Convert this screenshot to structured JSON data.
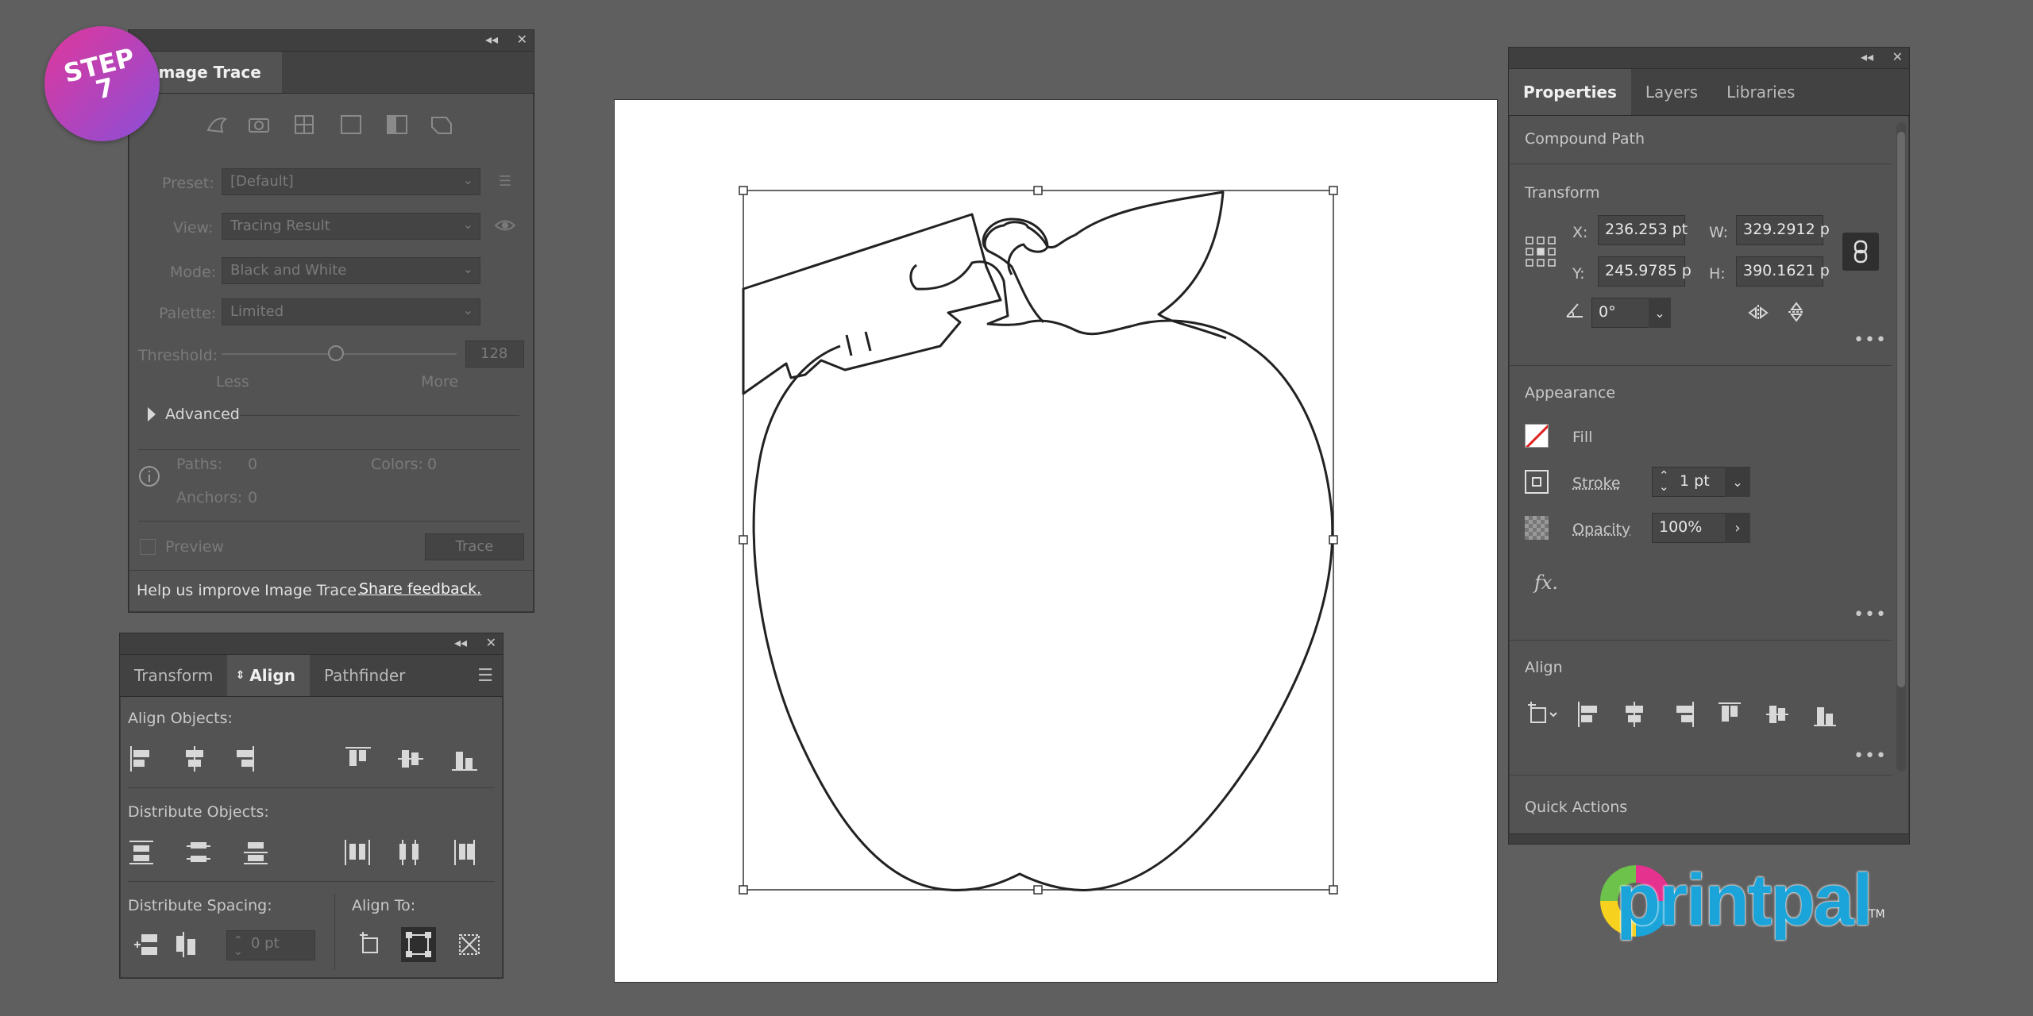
{
  "step_badge": {
    "line1": "STEP",
    "line2": "7"
  },
  "image_trace": {
    "tab_title": "Image Trace",
    "preset_label": "Preset:",
    "preset_value": "[Default]",
    "view_label": "View:",
    "view_value": "Tracing Result",
    "mode_label": "Mode:",
    "mode_value": "Black and White",
    "palette_label": "Palette:",
    "palette_value": "Limited",
    "threshold_label": "Threshold:",
    "threshold_value": "128",
    "less_label": "Less",
    "more_label": "More",
    "advanced_label": "Advanced",
    "paths_label": "Paths:",
    "paths_value": "0",
    "colors_label": "Colors:",
    "colors_value": "0",
    "anchors_label": "Anchors:",
    "anchors_value": "0",
    "preview_label": "Preview",
    "trace_button": "Trace",
    "help_text": "Help us improve Image Trace.",
    "feedback_link": "Share feedback."
  },
  "align_panel": {
    "tabs": [
      "Transform",
      "Align",
      "Pathfinder"
    ],
    "align_objects": "Align Objects:",
    "distribute_objects": "Distribute Objects:",
    "distribute_spacing": "Distribute Spacing:",
    "align_to": "Align To:",
    "spacing_value": "0 pt"
  },
  "properties": {
    "tabs": [
      "Properties",
      "Layers",
      "Libraries"
    ],
    "object_type": "Compound Path",
    "transform_title": "Transform",
    "x_label": "X:",
    "x_value": "236.253 pt",
    "y_label": "Y:",
    "y_value": "245.9785 p",
    "w_label": "W:",
    "w_value": "329.2912 p",
    "h_label": "H:",
    "h_value": "390.1621 p",
    "angle_value": "0°",
    "appearance_title": "Appearance",
    "fill_label": "Fill",
    "stroke_label": "Stroke",
    "stroke_value": "1 pt",
    "opacity_label": "Opacity",
    "opacity_value": "100%",
    "fx_label": "fx.",
    "align_title": "Align",
    "quick_actions": "Quick Actions"
  },
  "logo": {
    "text": "printpal",
    "tm": "TM"
  },
  "colors": {
    "background": "#5f5f5f",
    "panel": "#535353",
    "badge_start": "#e0379b",
    "badge_end": "#8a4fd8",
    "logo_blue": "#1aa4d9"
  }
}
